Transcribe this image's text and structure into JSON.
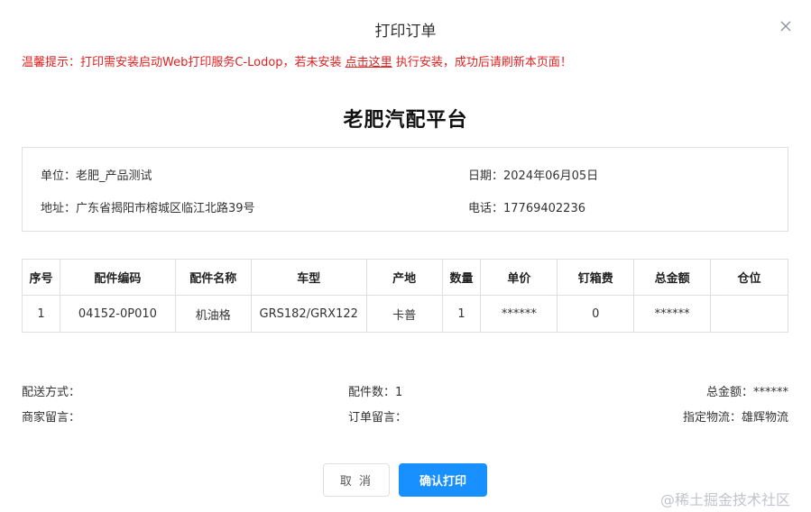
{
  "dialog": {
    "title": "打印订单",
    "notice_before": "温馨提示：打印需安装启动Web打印服务C-Lodop，若未安装 ",
    "notice_link": "点击这里",
    "notice_after": " 执行安装，成功后请刷新本页面！"
  },
  "order": {
    "company": "老肥汽配平台",
    "unit": "单位：老肥_产品测试",
    "date": "日期：2024年06月05日",
    "address": "地址：广东省揭阳市榕城区临江北路39号",
    "phone": "电话：17769402236"
  },
  "table": {
    "headers": [
      "序号",
      "配件编码",
      "配件名称",
      "车型",
      "产地",
      "数量",
      "单价",
      "钉箱费",
      "总金额",
      "仓位"
    ],
    "rows": [
      [
        "1",
        "04152-0P010",
        "机油格",
        "GRS182/GRX122",
        "卡普",
        "1",
        "******",
        "0",
        "******",
        ""
      ]
    ]
  },
  "summary": {
    "delivery": "配送方式：",
    "parts_count": "配件数：1",
    "total": "总金额：******",
    "merchant_note": "商家留言：",
    "order_note": "订单留言：",
    "logistics": "指定物流：雄辉物流"
  },
  "buttons": {
    "cancel": "取 消",
    "confirm": "确认打印"
  },
  "watermark": "@稀土掘金技术社区"
}
